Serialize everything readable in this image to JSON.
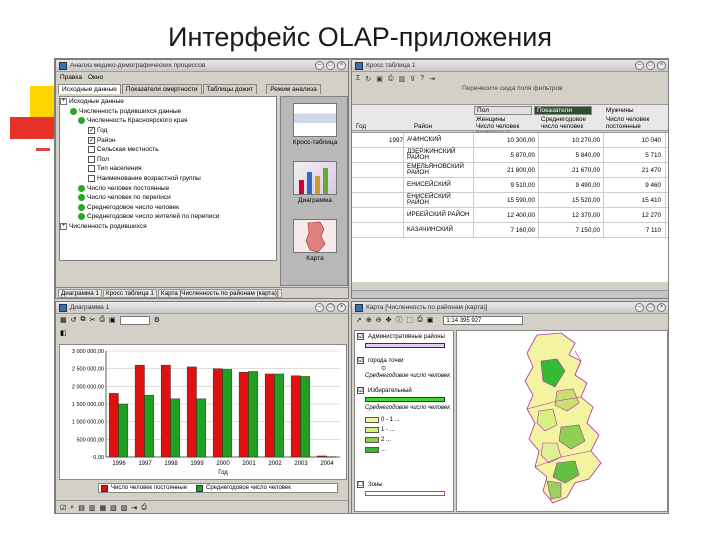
{
  "slide": {
    "title": "Интерфейс OLAP-приложения"
  },
  "w1": {
    "title": "Анализ медико-демографических процессов",
    "menu": [
      "Правка",
      "Окно"
    ],
    "tabs": [
      "Исходные данные",
      "Показатели смертности",
      "Таблицы дожит"
    ],
    "side_tab": "Режим анализа",
    "tree": [
      {
        "text": "Исходные данные",
        "kind": "plus"
      },
      {
        "text": "Численность родившихся данные",
        "kind": "dot"
      },
      {
        "text": "Численность Красноярского края",
        "kind": "dot"
      },
      {
        "text": "Год",
        "kind": "check"
      },
      {
        "text": "Район",
        "kind": "check"
      },
      {
        "text": "Сельская местность",
        "kind": "check"
      },
      {
        "text": "Пол",
        "kind": "check"
      },
      {
        "text": "Тип населения",
        "kind": "check"
      },
      {
        "text": "Наименование возрастной группы",
        "kind": "check"
      },
      {
        "text": "Число человек постоянные",
        "kind": "dot"
      },
      {
        "text": "Число человек по переписи",
        "kind": "dot"
      },
      {
        "text": "Среднегодовое число человек",
        "kind": "dot"
      },
      {
        "text": "Среднегодовое число жителей по переписи",
        "kind": "dot"
      },
      {
        "text": "Численность родившихся",
        "kind": "plus"
      }
    ],
    "side_items": [
      "Кросс-таблица",
      "Диаграмма",
      "Карта"
    ],
    "status_tabs": [
      "Диаграмма 1",
      "Кросс таблица 1",
      "Карта [Численность по районам (карта)]"
    ]
  },
  "w2": {
    "title": "Кросс таблица 1",
    "caption": "Перенесите сюда поля фильтров",
    "head": {
      "field_pol": "Пол",
      "field_pokaz": "Показатели",
      "col_group": "Мужчины",
      "col_zhen": "Женщины",
      "col_a": "Число человек постоянные",
      "col_b": "Среднегодовое число человек",
      "col_c": "Число человек постоянные",
      "row_god": "Год",
      "row_rayon": "Район"
    },
    "rows": [
      {
        "year": "1997",
        "district": "АЧИНСКИЙ",
        "a": "10 300,00",
        "b": "10 270,00",
        "c": "10 040"
      },
      {
        "year": "",
        "district": "ДЗЕРЖИНСКИЙ РАЙОН",
        "a": "5 870,00",
        "b": "5 840,00",
        "c": "5 710"
      },
      {
        "year": "",
        "district": "ЕМЕЛЬЯНОВСКИЙ РАЙОН",
        "a": "21 800,00",
        "b": "21 670,00",
        "c": "21 470"
      },
      {
        "year": "",
        "district": "ЕНИСЕЙСКИЙ",
        "a": "9 510,00",
        "b": "9 490,00",
        "c": "9 460"
      },
      {
        "year": "",
        "district": "ЕНИСЕЙСКИЙ РАЙОН",
        "a": "15 590,00",
        "b": "15 520,00",
        "c": "15 410"
      },
      {
        "year": "",
        "district": "ИРБЕЙСКИЙ РАЙОН",
        "a": "12 400,00",
        "b": "12 370,00",
        "c": "12 270"
      },
      {
        "year": "",
        "district": "КАЗАЧИНСКИЙ",
        "a": "7 160,00",
        "b": "7 150,00",
        "c": "7 110"
      }
    ]
  },
  "w3": {
    "title": "Диаграмма 1",
    "legend": [
      "Число человек постоянные",
      "Среднегодовое число человек"
    ],
    "bottom_label": "",
    "colors": {
      "s1": "#e01010",
      "s2": "#20a020"
    }
  },
  "w4": {
    "title": "Карта [Численность по районам (карта)]",
    "scale": "1:14 395 927",
    "layers": [
      "Административные районы",
      "города точки",
      "Среднегодовое число человек",
      "Избирательный",
      "Среднегодовое число человек",
      "Зоны"
    ],
    "legend_classes": [
      "0 - 1 ...",
      "1 - ...",
      "2 ...",
      "..."
    ]
  },
  "chart_data": {
    "type": "bar",
    "categories": [
      "1996",
      "1997",
      "1998",
      "1999",
      "2000",
      "2001",
      "2002",
      "2003",
      "2004"
    ],
    "series": [
      {
        "name": "Число человек постоянные",
        "values": [
          1800000,
          2600000,
          2600000,
          2550000,
          2500000,
          2400000,
          2350000,
          2300000,
          30000
        ]
      },
      {
        "name": "Среднегодовое число человек",
        "values": [
          1500000,
          1750000,
          1650000,
          1650000,
          2480000,
          2420000,
          2350000,
          2280000,
          10000
        ]
      }
    ],
    "xlabel": "Год",
    "ylabel": "",
    "ylim": [
      0,
      3000000
    ],
    "yticks": [
      "0,00",
      "500 000,00",
      "1 000 000,00",
      "1 500 000,00",
      "2 000 000,00",
      "2 500 000,00",
      "3 000 000,00"
    ],
    "grid": true
  }
}
